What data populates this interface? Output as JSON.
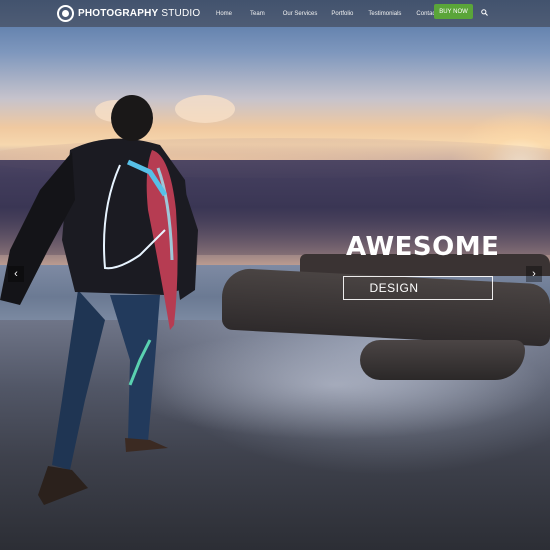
{
  "brand": {
    "logo_bold": "PHOTOGRAPHY",
    "logo_light": "STUDIO"
  },
  "nav": {
    "items": [
      {
        "label": "Home"
      },
      {
        "label": "Team"
      },
      {
        "label": "Our Services"
      },
      {
        "label": "Portfolio"
      },
      {
        "label": "Testimonials"
      },
      {
        "label": "Contact Us"
      }
    ],
    "buy_label": "BUY NOW",
    "icons": {
      "search": "search-icon"
    }
  },
  "hero": {
    "headline": "AWESOME",
    "subline": "DESIGN",
    "prev_arrow": "‹",
    "next_arrow": "›"
  },
  "colors": {
    "accent": "#5aa539",
    "nav_bg": "#3c3c46",
    "text": "#ffffff"
  }
}
